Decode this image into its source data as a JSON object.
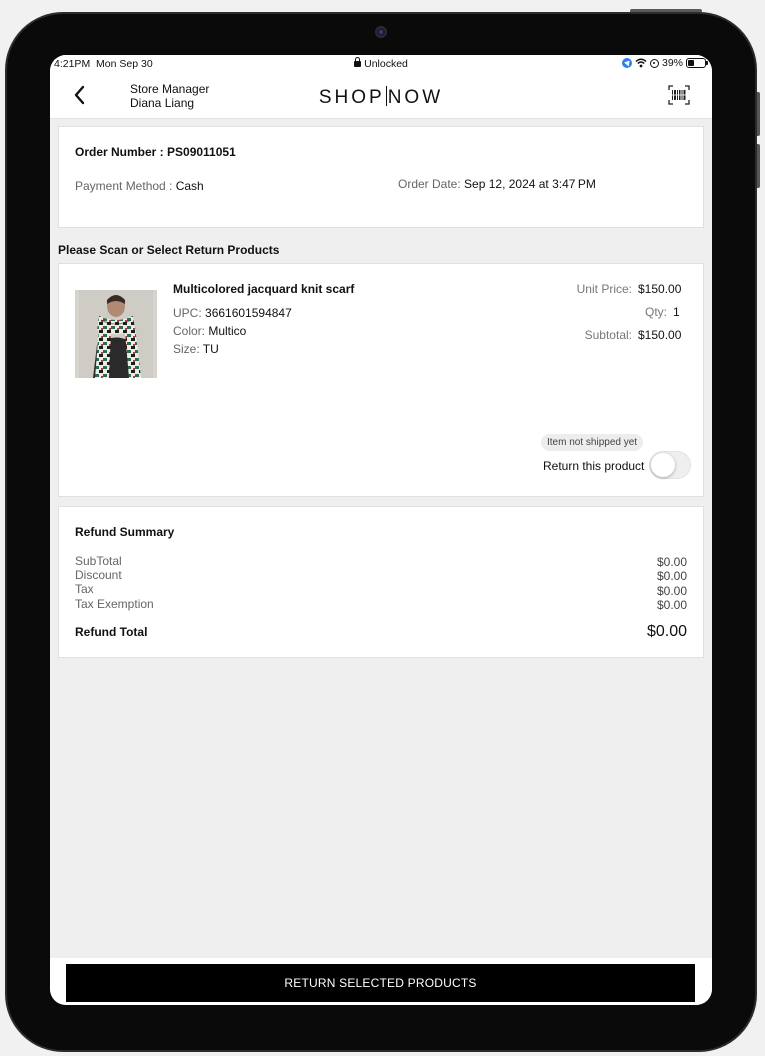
{
  "status_bar": {
    "time": "4:21PM",
    "date": "Mon Sep 30",
    "lock_status": "Unlocked",
    "battery": "39%",
    "battery_level": 0.39
  },
  "nav": {
    "role": "Store Manager",
    "user": "Diana Liang",
    "brand_left": "SHOP",
    "brand_right": "NOW",
    "back_icon": "chevron-left-icon",
    "scan_icon": "barcode-scan-icon"
  },
  "order": {
    "number_label": "Order Number : ",
    "number": "PS09011051",
    "payment_label": "Payment Method : ",
    "payment": "Cash",
    "date_label": "Order Date: ",
    "date": "Sep 12, 2024 at 3:47 PM"
  },
  "section_title": "Please Scan or Select Return Products",
  "product": {
    "name": "Multicolored jacquard knit scarf",
    "upc_label": "UPC: ",
    "upc": "3661601594847",
    "color_label": "Color: ",
    "color": "Multico",
    "size_label": "Size: ",
    "size": "TU",
    "unit_price_label": "Unit Price:",
    "unit_price": "$150.00",
    "qty_label": "Qty:",
    "qty": "1",
    "subtotal_label": "Subtotal:",
    "subtotal": "$150.00",
    "ship_status": "Item not shipped yet",
    "return_label": "Return this product",
    "return_selected": false
  },
  "refund": {
    "title": "Refund Summary",
    "rows": [
      {
        "label": "SubTotal",
        "value": "$0.00"
      },
      {
        "label": "Discount",
        "value": "$0.00"
      },
      {
        "label": "Tax",
        "value": "$0.00"
      },
      {
        "label": "Tax Exemption",
        "value": "$0.00"
      }
    ],
    "total_label": "Refund Total",
    "total": "$0.00"
  },
  "footer": {
    "button_label": "RETURN SELECTED PRODUCTS"
  }
}
